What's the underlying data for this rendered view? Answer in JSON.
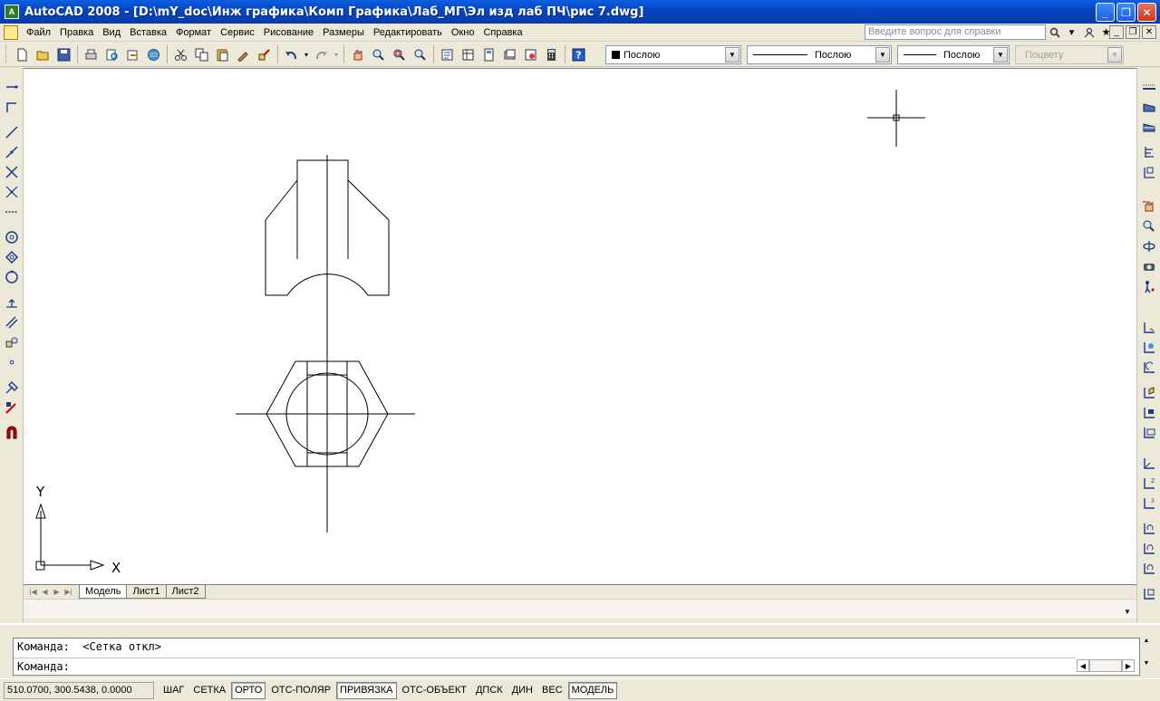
{
  "window": {
    "title": "AutoCAD 2008 - [D:\\mY_doc\\Инж графика\\Комп Графика\\Лаб_МГ\\Эл изд лаб ПЧ\\рис 7.dwg]",
    "app_icon": "autocad-app-icon",
    "minimize": "_",
    "restore": "❐",
    "close": "✕"
  },
  "menu": {
    "items": [
      "Файл",
      "Правка",
      "Вид",
      "Вставка",
      "Формат",
      "Сервис",
      "Рисование",
      "Размеры",
      "Редактировать",
      "Окно",
      "Справка"
    ],
    "help_placeholder": "Введите вопрос для справки"
  },
  "toolbar": {
    "layer_combo": "Послою",
    "linetype_combo": "Послою",
    "lineweight_combo": "Послою",
    "plotstyle_combo": "Поцвету"
  },
  "ucs": {
    "x_label": "X",
    "y_label": "Y"
  },
  "tabs": {
    "items": [
      "Модель",
      "Лист1",
      "Лист2"
    ],
    "active": "Модель"
  },
  "command": {
    "history_line": "Команда:  <Сетка откл>",
    "prompt_line": "Команда:"
  },
  "status": {
    "coordinates": "510.0700, 300.5438, 0.0000",
    "buttons": [
      {
        "label": "ШАГ",
        "on": false
      },
      {
        "label": "СЕТКА",
        "on": false
      },
      {
        "label": "ОРТО",
        "on": true
      },
      {
        "label": "ОТС-ПОЛЯР",
        "on": false
      },
      {
        "label": "ПРИВЯЗКА",
        "on": true
      },
      {
        "label": "ОТС-ОБЪЕКТ",
        "on": false
      },
      {
        "label": "ДПСК",
        "on": false
      },
      {
        "label": "ДИН",
        "on": false
      },
      {
        "label": "ВЕС",
        "on": false
      },
      {
        "label": "МОДЕЛЬ",
        "on": true
      }
    ]
  },
  "colors": {
    "titlebar": "#0a5fe0",
    "chrome": "#ece9d8",
    "canvas": "#ffffff",
    "drawing_stroke": "#000000"
  }
}
